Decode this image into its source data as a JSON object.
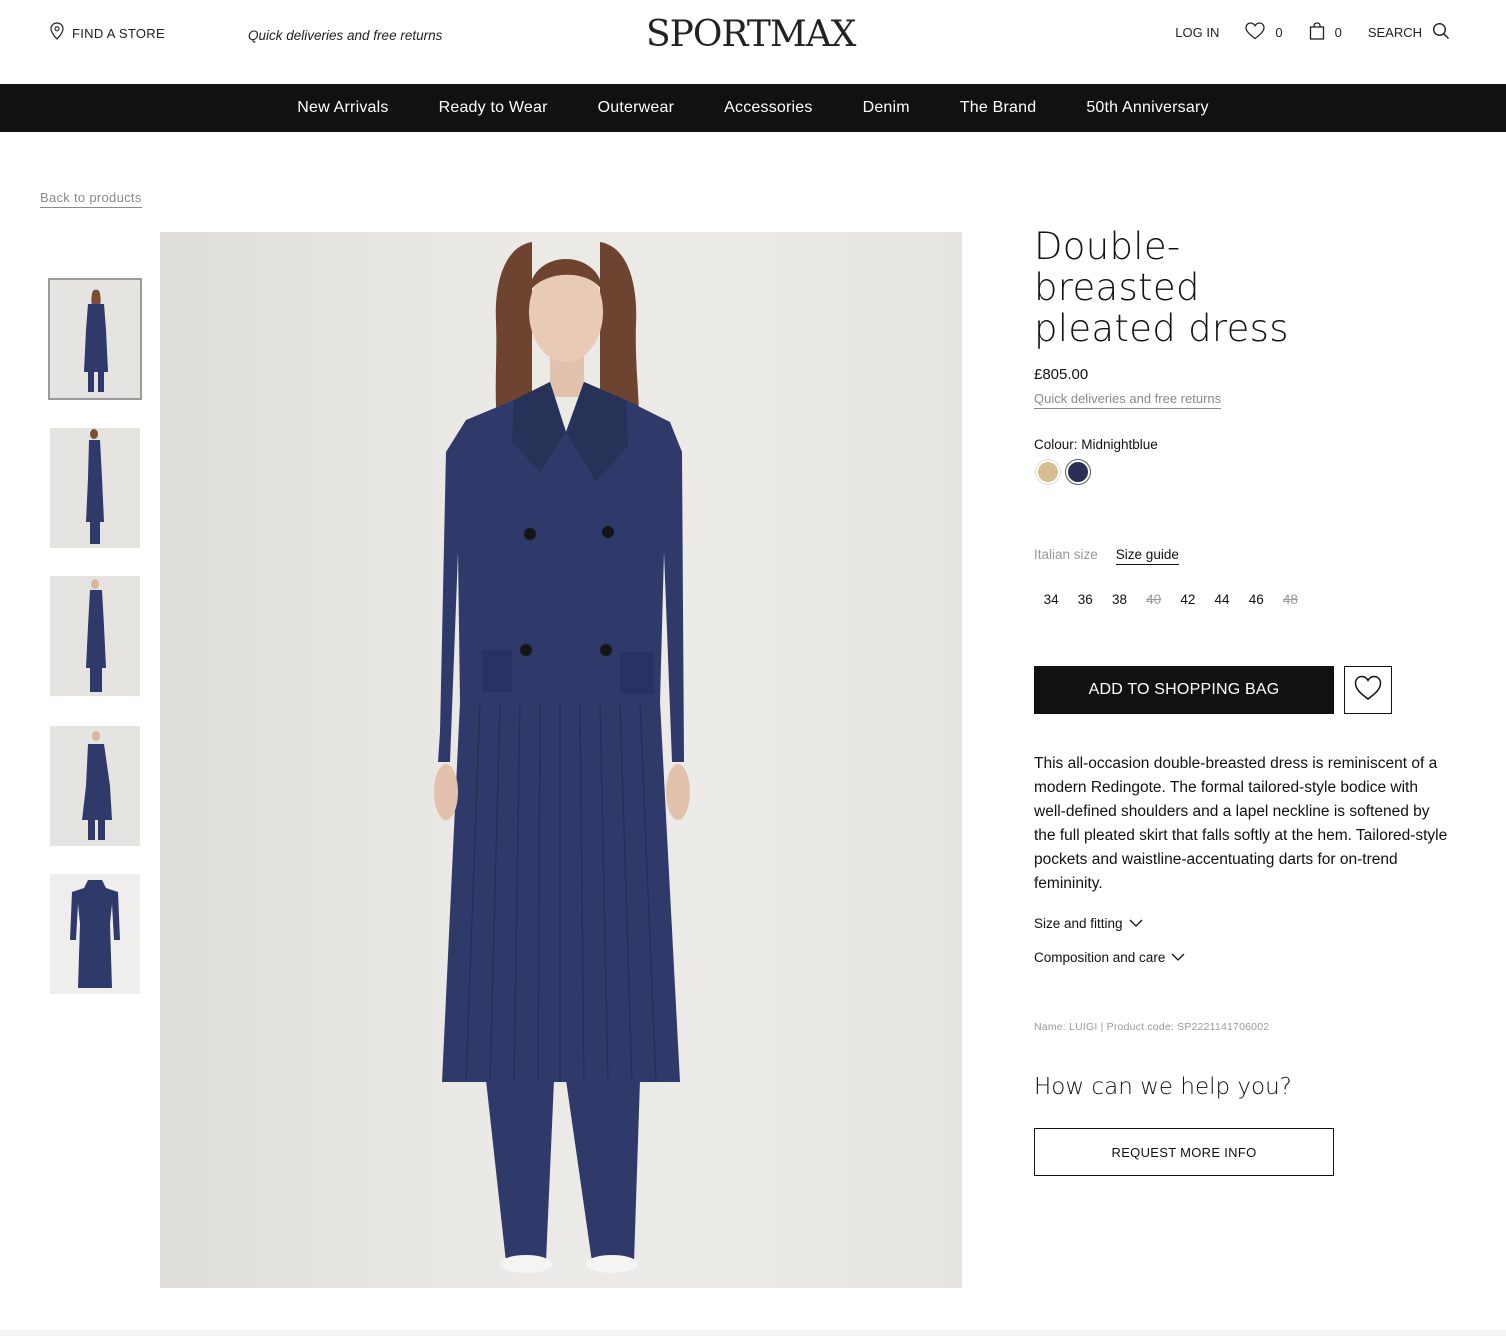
{
  "header": {
    "find_store": "FIND A STORE",
    "promo": "Quick deliveries and free returns",
    "logo": "SPORTMAX",
    "login": "LOG IN",
    "wishlist_count": "0",
    "bag_count": "0",
    "search": "SEARCH"
  },
  "nav": {
    "items": [
      "New Arrivals",
      "Ready to Wear",
      "Outerwear",
      "Accessories",
      "Denim",
      "The Brand",
      "50th Anniversary"
    ]
  },
  "back_link": "Back to products",
  "product": {
    "title": "Double-breasted pleated dress",
    "price": "£805.00",
    "delivery_link": "Quick deliveries and free returns",
    "colour_label": "Colour: Midnightblue",
    "swatches": [
      {
        "name": "beige",
        "color": "#d8bf8f",
        "selected": false
      },
      {
        "name": "midnightblue",
        "color": "#2a2f55",
        "selected": true
      }
    ],
    "size_type": "Italian size",
    "size_guide": "Size guide",
    "sizes": [
      {
        "label": "34",
        "available": true
      },
      {
        "label": "36",
        "available": true
      },
      {
        "label": "38",
        "available": true
      },
      {
        "label": "40",
        "available": false
      },
      {
        "label": "42",
        "available": true
      },
      {
        "label": "44",
        "available": true
      },
      {
        "label": "46",
        "available": true
      },
      {
        "label": "48",
        "available": false
      }
    ],
    "add_to_bag": "ADD TO SHOPPING BAG",
    "description": "This all-occasion double-breasted dress is reminiscent of a modern Redingote. The formal tailored-style bodice with well-defined shoulders and a lapel neckline is softened by the full pleated skirt that falls softly at the hem. Tailored-style pockets and waistline-accentuating darts for on-trend femininity.",
    "accordion": [
      "Size and fitting",
      "Composition and care"
    ],
    "code_line": "Name: LUIGI | Product code: SP2221141706002",
    "help_title": "How can we help you?",
    "request_info": "REQUEST MORE INFO"
  },
  "colors": {
    "nav_bg": "#111114",
    "garment": "#2f3a6b",
    "muted_text": "#8a8a8a"
  }
}
